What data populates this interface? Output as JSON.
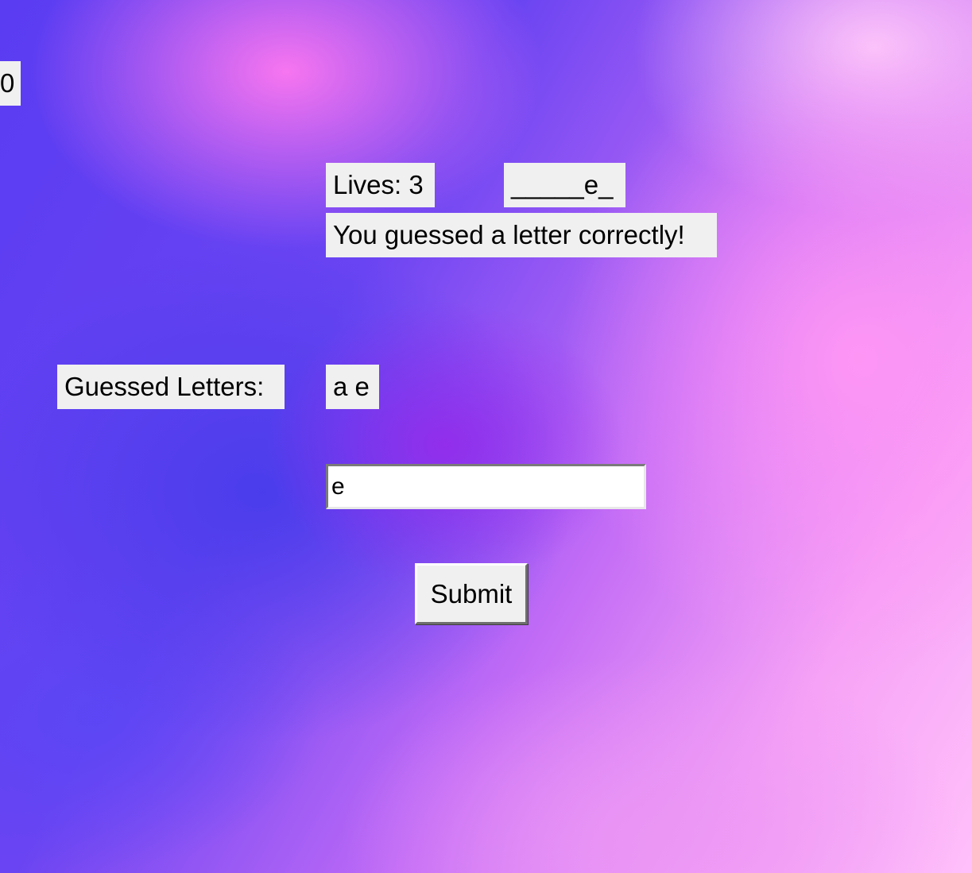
{
  "game": {
    "score": "0",
    "lives_label": "Lives: 3",
    "word_display": "_____e_",
    "message": "You guessed a letter correctly!",
    "guessed_title": "Guessed Letters:",
    "guessed_letters": "a e"
  },
  "form": {
    "guess_input_value": "e",
    "submit_label": "Submit"
  },
  "colors": {
    "label_background": "#f0f0f0",
    "background_violet": "#5a3cf2",
    "background_pink": "#ff8cf0",
    "background_light_pink": "#ffc0fa"
  }
}
